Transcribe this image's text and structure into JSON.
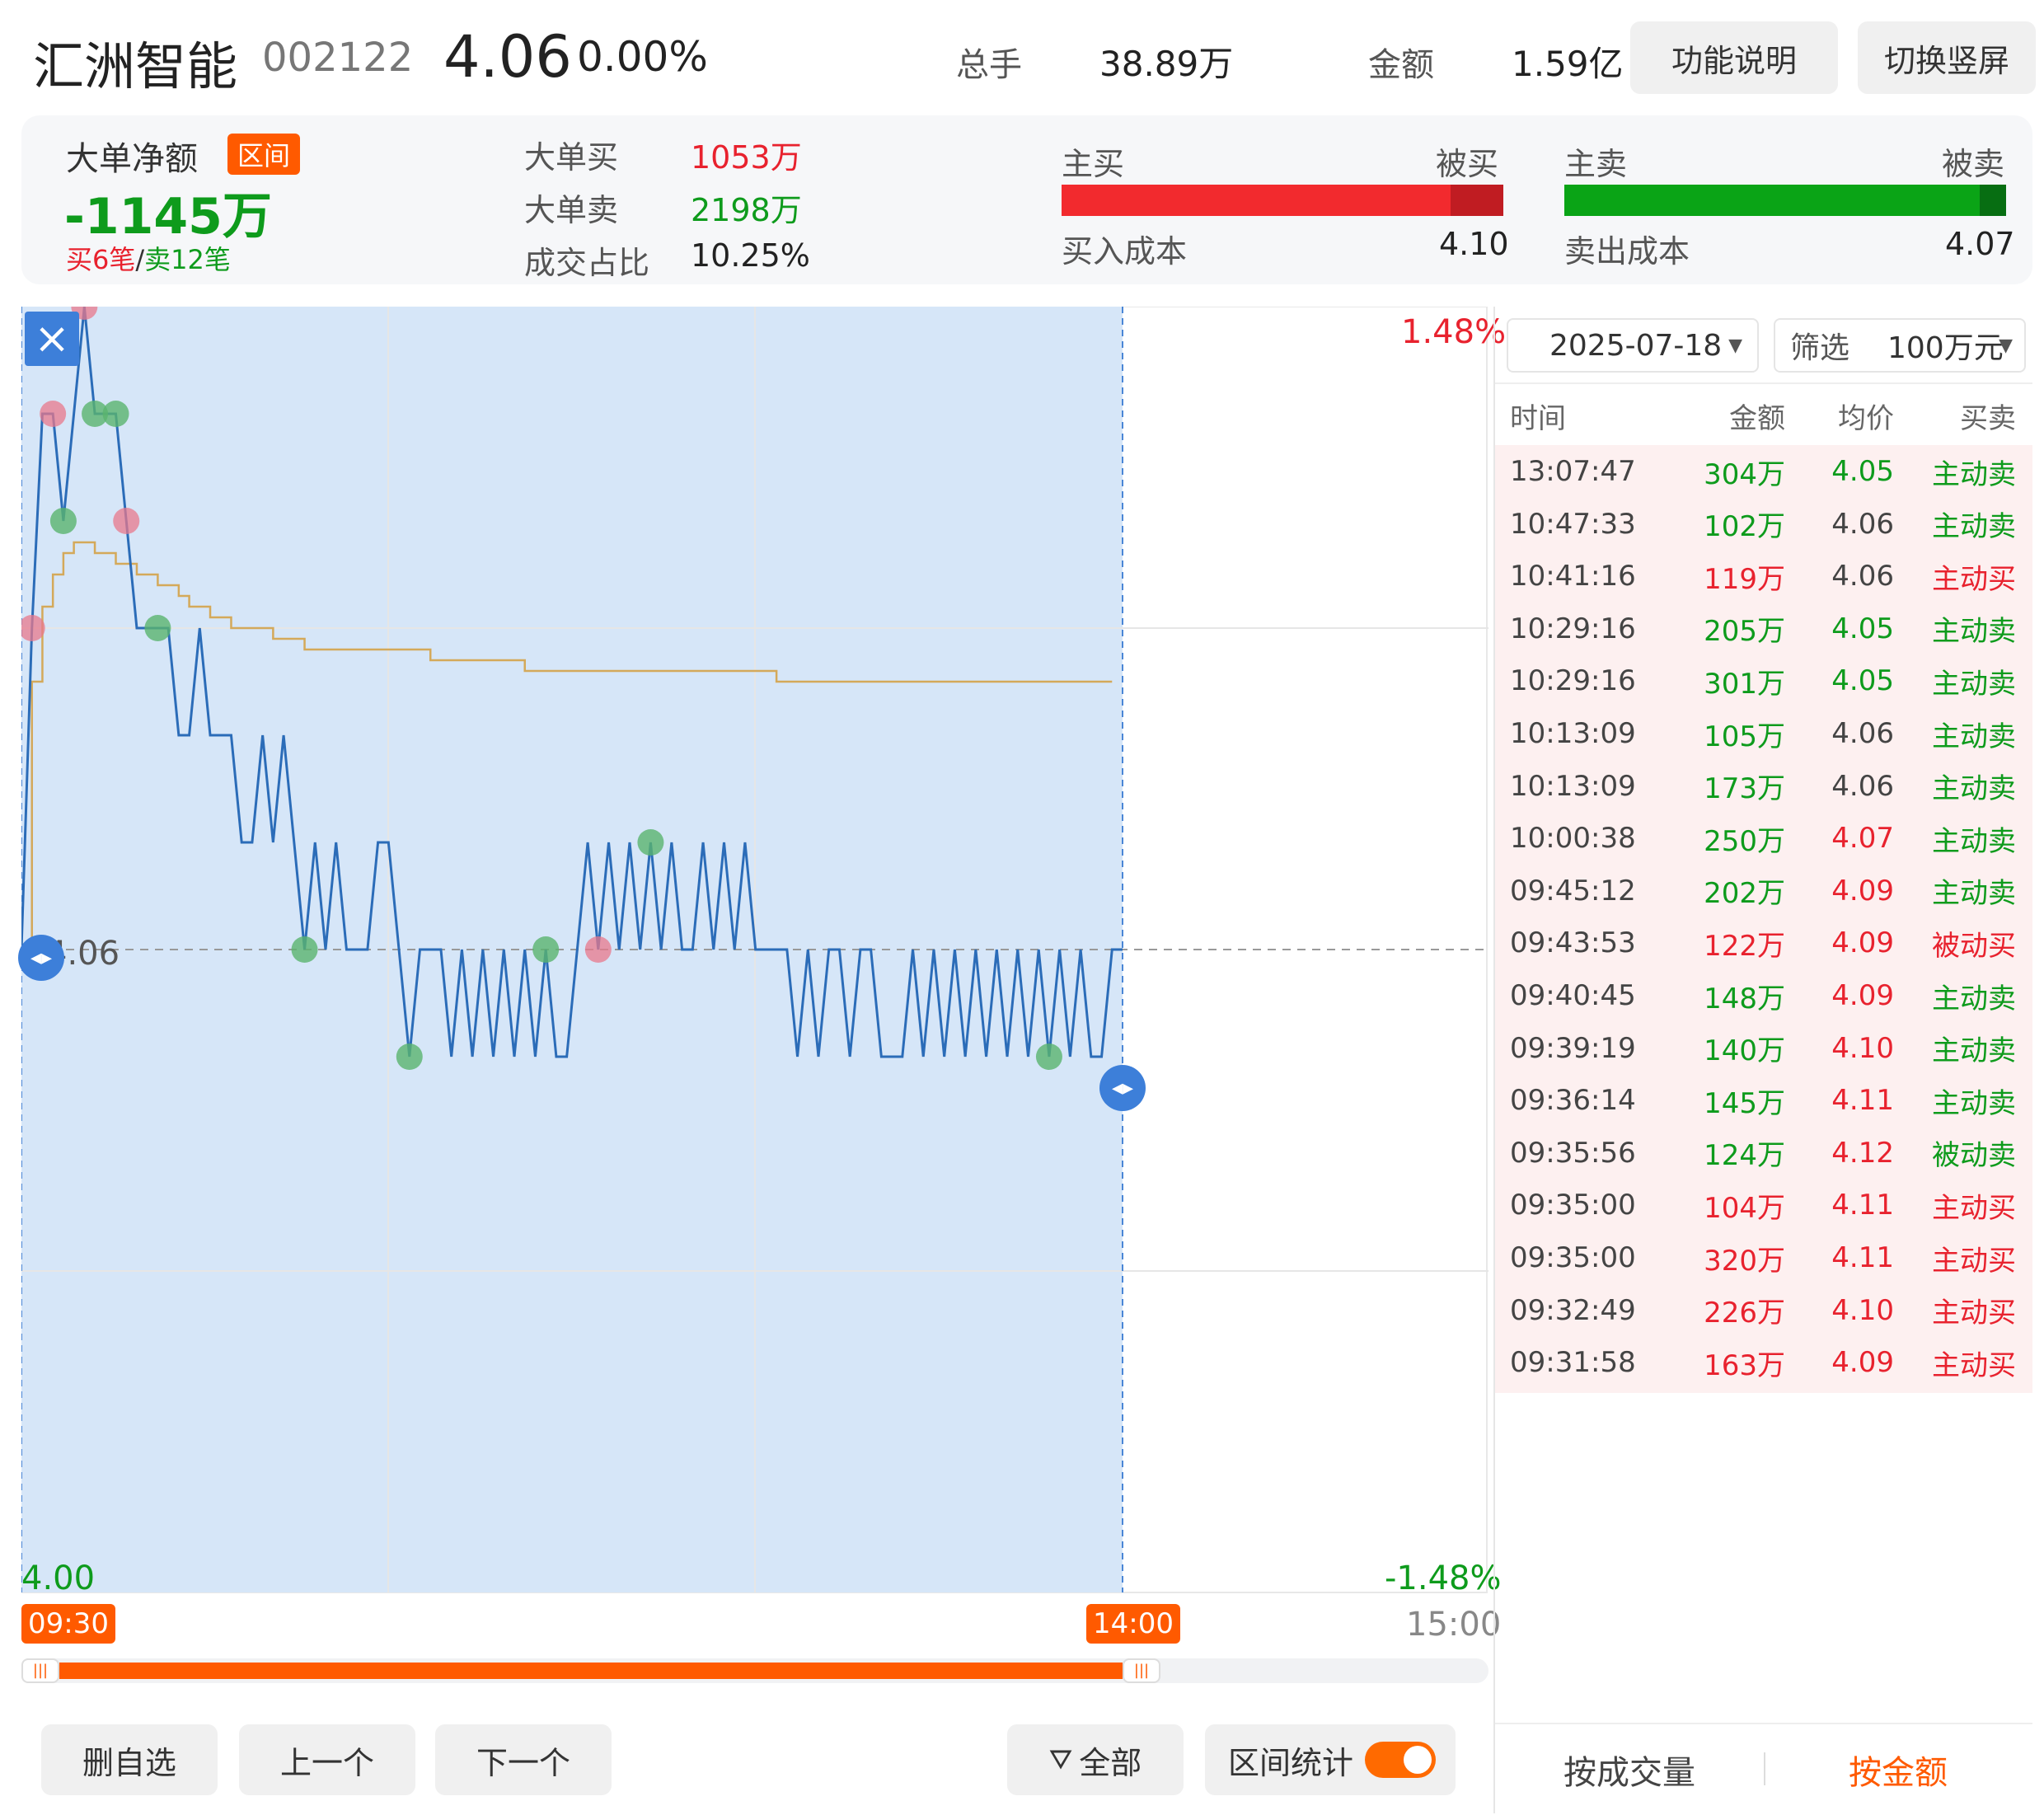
{
  "header": {
    "stock_name": "汇洲智能",
    "stock_code": "002122",
    "price": "4.06",
    "change_pct": "0.00%",
    "volume_label": "总手",
    "volume_value": "38.89万",
    "amount_label": "金额",
    "amount_value": "1.59亿",
    "help_button": "功能说明",
    "switch_button": "切换竖屏"
  },
  "stats": {
    "net_label": "大单净额",
    "range_badge": "区间",
    "net_value": "-1145万",
    "buy_count": "买6笔",
    "separator": "/",
    "sell_count": "卖12笔",
    "big_buy_label": "大单买",
    "big_buy_value": "1053万",
    "big_sell_label": "大单卖",
    "big_sell_value": "2198万",
    "ratio_label": "成交占比",
    "ratio_value": "10.25%",
    "active_buy_label": "主买",
    "passive_buy_label": "被买",
    "buy_cost_label": "买入成本",
    "buy_cost_value": "4.10",
    "active_sell_label": "主卖",
    "passive_sell_label": "被卖",
    "sell_cost_label": "卖出成本",
    "sell_cost_value": "4.07",
    "buy_active_fraction": 0.88,
    "sell_active_fraction": 0.94
  },
  "chart": {
    "price_high": "4.12",
    "price_base": "4.06",
    "price_low": "4.00",
    "pct_high": "1.48%",
    "pct_low": "-1.48%",
    "time_start": "09:30",
    "time_selected_end": "14:00",
    "time_end": "15:00",
    "close_icon": "×",
    "colors": {
      "price_line": "#2b6cb8",
      "avg_line": "#d4a95a",
      "selection": "#d6e6f8",
      "accent": "#ff5a00"
    }
  },
  "chart_data": {
    "type": "line",
    "ylim": [
      4.0,
      4.12
    ],
    "base": 4.06,
    "series": [
      {
        "values": [
          4.06,
          4.09,
          4.11,
          4.11,
          4.1,
          4.11,
          4.12,
          4.11,
          4.11,
          4.11,
          4.1,
          4.09,
          4.09,
          4.09,
          4.09,
          4.08,
          4.08,
          4.09,
          4.08,
          4.08,
          4.08,
          4.07,
          4.07,
          4.08,
          4.07,
          4.08,
          4.07,
          4.06,
          4.07,
          4.06,
          4.07,
          4.06,
          4.06,
          4.06,
          4.07,
          4.07,
          4.06,
          4.05,
          4.06,
          4.06,
          4.06,
          4.05,
          4.06,
          4.05,
          4.06,
          4.05,
          4.06,
          4.05,
          4.06,
          4.05,
          4.06,
          4.05,
          4.05,
          4.06,
          4.07,
          4.06,
          4.07,
          4.06,
          4.07,
          4.06,
          4.07,
          4.06,
          4.07,
          4.06,
          4.06,
          4.07,
          4.06,
          4.07,
          4.06,
          4.07,
          4.06,
          4.06,
          4.06,
          4.06,
          4.05,
          4.06,
          4.05,
          4.06,
          4.06,
          4.05,
          4.06,
          4.06,
          4.05,
          4.05,
          4.05,
          4.06,
          4.05,
          4.06,
          4.05,
          4.06,
          4.05,
          4.06,
          4.05,
          4.06,
          4.05,
          4.06,
          4.05,
          4.06,
          4.05,
          4.06,
          4.05,
          4.06,
          4.05,
          4.05,
          4.06,
          4.06
        ]
      },
      {
        "values": [
          4.06,
          4.085,
          4.092,
          4.095,
          4.097,
          4.098,
          4.098,
          4.097,
          4.097,
          4.096,
          4.096,
          4.095,
          4.095,
          4.094,
          4.094,
          4.093,
          4.092,
          4.092,
          4.091,
          4.091,
          4.09,
          4.09,
          4.09,
          4.09,
          4.089,
          4.089,
          4.089,
          4.088,
          4.088,
          4.088,
          4.088,
          4.088,
          4.088,
          4.088,
          4.088,
          4.088,
          4.088,
          4.088,
          4.088,
          4.087,
          4.087,
          4.087,
          4.087,
          4.087,
          4.087,
          4.087,
          4.087,
          4.087,
          4.086,
          4.086,
          4.086,
          4.086,
          4.086,
          4.086,
          4.086,
          4.086,
          4.086,
          4.086,
          4.086,
          4.086,
          4.086,
          4.086,
          4.086,
          4.086,
          4.086,
          4.086,
          4.086,
          4.086,
          4.086,
          4.086,
          4.086,
          4.086,
          4.085,
          4.085,
          4.085,
          4.085,
          4.085,
          4.085,
          4.085,
          4.085,
          4.085,
          4.085,
          4.085,
          4.085,
          4.085,
          4.085,
          4.085,
          4.085,
          4.085,
          4.085,
          4.085,
          4.085,
          4.085,
          4.085,
          4.085,
          4.085,
          4.085,
          4.085,
          4.085,
          4.085,
          4.085,
          4.085,
          4.085,
          4.085,
          4.085
        ]
      }
    ],
    "trade_markers": [
      {
        "i": 6,
        "type": "buy"
      },
      {
        "i": 3,
        "type": "buy"
      },
      {
        "i": 4,
        "type": "sell"
      },
      {
        "i": 7,
        "type": "sell"
      },
      {
        "i": 1,
        "type": "buy"
      },
      {
        "i": 9,
        "type": "sell"
      },
      {
        "i": 10,
        "type": "buy"
      },
      {
        "i": 13,
        "type": "sell"
      },
      {
        "i": 27,
        "type": "sell"
      },
      {
        "i": 37,
        "type": "sell"
      },
      {
        "i": 50,
        "type": "sell"
      },
      {
        "i": 55,
        "type": "buy"
      },
      {
        "i": 60,
        "type": "sell"
      },
      {
        "i": 98,
        "type": "sell"
      }
    ]
  },
  "trades": {
    "date": "2025-07-18",
    "filter_label": "筛选",
    "filter_value": "100万元",
    "columns": [
      "时间",
      "金额",
      "均价",
      "买卖"
    ],
    "rows": [
      {
        "time": "13:07:47",
        "amount": "304万",
        "avg": "4.05",
        "side": "主动卖",
        "color": "green",
        "avg_color": "green"
      },
      {
        "time": "10:47:33",
        "amount": "102万",
        "avg": "4.06",
        "side": "主动卖",
        "color": "green",
        "avg_color": "gray"
      },
      {
        "time": "10:41:16",
        "amount": "119万",
        "avg": "4.06",
        "side": "主动买",
        "color": "red",
        "avg_color": "gray"
      },
      {
        "time": "10:29:16",
        "amount": "205万",
        "avg": "4.05",
        "side": "主动卖",
        "color": "green",
        "avg_color": "green"
      },
      {
        "time": "10:29:16",
        "amount": "301万",
        "avg": "4.05",
        "side": "主动卖",
        "color": "green",
        "avg_color": "green"
      },
      {
        "time": "10:13:09",
        "amount": "105万",
        "avg": "4.06",
        "side": "主动卖",
        "color": "green",
        "avg_color": "gray"
      },
      {
        "time": "10:13:09",
        "amount": "173万",
        "avg": "4.06",
        "side": "主动卖",
        "color": "green",
        "avg_color": "gray"
      },
      {
        "time": "10:00:38",
        "amount": "250万",
        "avg": "4.07",
        "side": "主动卖",
        "color": "green",
        "avg_color": "red"
      },
      {
        "time": "09:45:12",
        "amount": "202万",
        "avg": "4.09",
        "side": "主动卖",
        "color": "green",
        "avg_color": "red"
      },
      {
        "time": "09:43:53",
        "amount": "122万",
        "avg": "4.09",
        "side": "被动买",
        "color": "red",
        "avg_color": "red"
      },
      {
        "time": "09:40:45",
        "amount": "148万",
        "avg": "4.09",
        "side": "主动卖",
        "color": "green",
        "avg_color": "red"
      },
      {
        "time": "09:39:19",
        "amount": "140万",
        "avg": "4.10",
        "side": "主动卖",
        "color": "green",
        "avg_color": "red"
      },
      {
        "time": "09:36:14",
        "amount": "145万",
        "avg": "4.11",
        "side": "主动卖",
        "color": "green",
        "avg_color": "red"
      },
      {
        "time": "09:35:56",
        "amount": "124万",
        "avg": "4.12",
        "side": "被动卖",
        "color": "green",
        "avg_color": "red"
      },
      {
        "time": "09:35:00",
        "amount": "104万",
        "avg": "4.11",
        "side": "主动买",
        "color": "red",
        "avg_color": "red"
      },
      {
        "time": "09:35:00",
        "amount": "320万",
        "avg": "4.11",
        "side": "主动买",
        "color": "red",
        "avg_color": "red"
      },
      {
        "time": "09:32:49",
        "amount": "226万",
        "avg": "4.10",
        "side": "主动买",
        "color": "red",
        "avg_color": "red"
      },
      {
        "time": "09:31:58",
        "amount": "163万",
        "avg": "4.09",
        "side": "主动买",
        "color": "red",
        "avg_color": "red"
      }
    ],
    "tab_volume": "按成交量",
    "tab_amount": "按金额"
  },
  "footer": {
    "remove_watchlist": "删自选",
    "prev": "上一个",
    "next": "下一个",
    "filter_all": "全部",
    "range_stats": "区间统计"
  }
}
